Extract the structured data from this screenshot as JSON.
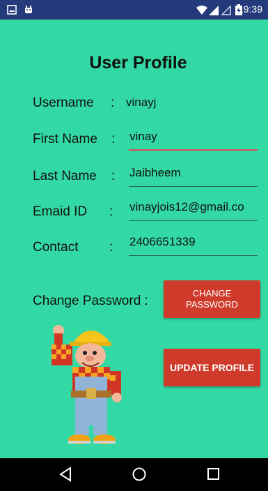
{
  "status_bar": {
    "time": "19:39",
    "icons": [
      "gallery-icon",
      "android-icon",
      "wifi-icon",
      "signal-icon",
      "signal-empty-icon",
      "battery-charging-icon"
    ]
  },
  "page_title": "User Profile",
  "form": {
    "username": {
      "label": "Username",
      "colon": ":",
      "value": "vinayj"
    },
    "first_name": {
      "label": "First Name",
      "colon": ":",
      "value": "vinay"
    },
    "last_name": {
      "label": "Last Name",
      "colon": ":",
      "value": "Jaibheem"
    },
    "email": {
      "label": "Emaid ID",
      "colon": ":",
      "value": "vinayjois12@gmail.co"
    },
    "contact": {
      "label": "Contact",
      "colon": ":",
      "value": "2406651339"
    }
  },
  "change_password": {
    "label": "Change Password :",
    "button_line1": "CHANGE",
    "button_line2": "PASSWORD"
  },
  "update_button": "UPDATE PROFILE",
  "nav": {
    "icons": [
      "back-icon",
      "home-icon",
      "recents-icon"
    ]
  },
  "colors": {
    "background": "#33d9a4",
    "status_bar": "#243a7b",
    "button": "#cf3b2b",
    "focus_underline": "#e24a5a"
  }
}
